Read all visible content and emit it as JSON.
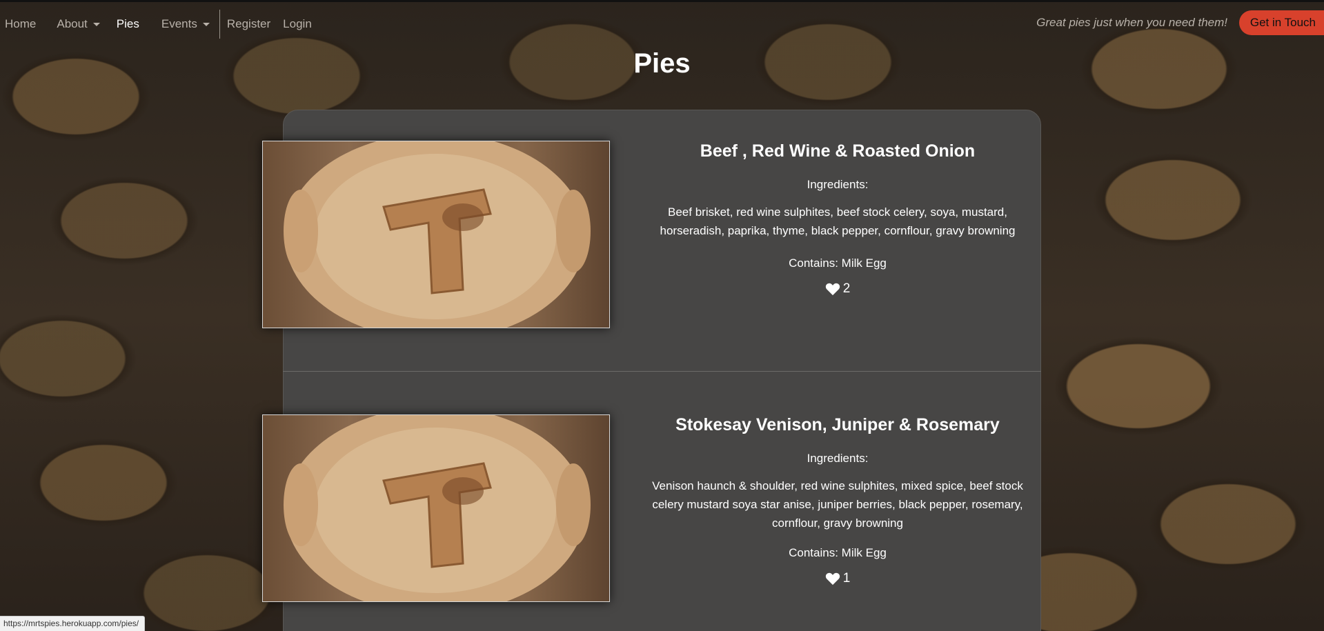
{
  "nav": {
    "items": [
      {
        "label": "Home",
        "has_caret": false,
        "active": false
      },
      {
        "label": "About",
        "has_caret": true,
        "active": false
      },
      {
        "label": "Pies",
        "has_caret": false,
        "active": true
      },
      {
        "label": "Events",
        "has_caret": true,
        "active": false
      }
    ],
    "auth_items": [
      {
        "label": "Register"
      },
      {
        "label": "Login"
      }
    ],
    "tagline": "Great pies just when you need them!",
    "contact_label": "Get in Touch"
  },
  "page": {
    "title": "Pies"
  },
  "pies": [
    {
      "name": "Beef , Red Wine & Roasted Onion",
      "ingredients_label": "Ingredients:",
      "ingredients_line1": "Beef brisket, red wine sulphites, beef stock celery, soya, mustard,",
      "ingredients_line2": "horseradish, paprika, thyme, black pepper, cornflour, gravy browning",
      "ingredients_line3": "",
      "contains": "Contains: Milk Egg",
      "likes": "2"
    },
    {
      "name": "Stokesay Venison, Juniper & Rosemary",
      "ingredients_label": "Ingredients:",
      "ingredients_line1": "Venison haunch & shoulder, red wine sulphites, mixed spice, beef stock",
      "ingredients_line2": "celery mustard soya star anise, juniper berries, black pepper, rosemary,",
      "ingredients_line3": "cornflour, gravy browning",
      "contains": "Contains: Milk Egg",
      "likes": "1"
    }
  ],
  "status_bar": {
    "url": "https://mrtspies.herokuapp.com/pies/"
  },
  "colors": {
    "accent": "#d8412c",
    "card_bg": "#474645",
    "nav_text": "#b9b2aa"
  }
}
